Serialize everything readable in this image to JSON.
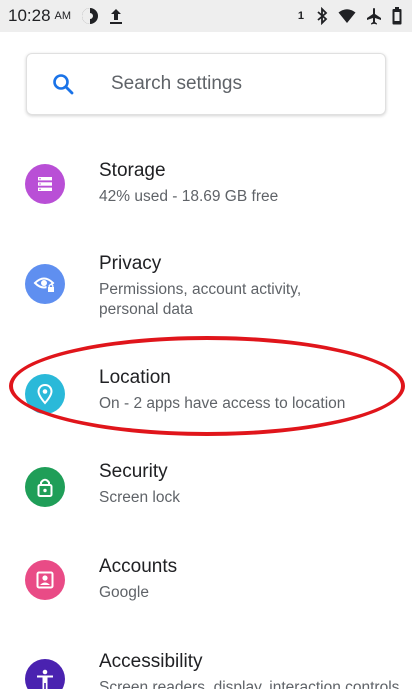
{
  "status_bar": {
    "time": "10:28",
    "ampm": "AM",
    "sim_number": "1",
    "icons": [
      "data-saver-icon",
      "upload-icon",
      "bluetooth-icon",
      "wifi-icon",
      "airplane-icon",
      "battery-icon"
    ]
  },
  "search": {
    "placeholder": "Search settings",
    "icon": "search-icon"
  },
  "accent_colors": {
    "storage": "#b94fd6",
    "privacy": "#5f8ff0",
    "location": "#2ab9d9",
    "security": "#1f9e58",
    "accounts": "#e94b86",
    "accessibility": "#4a22b0",
    "highlight": "#e0151b"
  },
  "settings": [
    {
      "id": "storage",
      "title": "Storage",
      "summary": "42% used - 18.69 GB free",
      "icon": "storage-icon"
    },
    {
      "id": "privacy",
      "title": "Privacy",
      "summary": "Permissions, account activity, personal data",
      "icon": "privacy-icon"
    },
    {
      "id": "location",
      "title": "Location",
      "summary": "On - 2 apps have access to location",
      "icon": "location-pin-icon"
    },
    {
      "id": "security",
      "title": "Security",
      "summary": "Screen lock",
      "icon": "lock-icon"
    },
    {
      "id": "accounts",
      "title": "Accounts",
      "summary": "Google",
      "icon": "accounts-icon"
    },
    {
      "id": "accessibility",
      "title": "Accessibility",
      "summary": "Screen readers, display, interaction controls",
      "icon": "accessibility-icon"
    }
  ]
}
